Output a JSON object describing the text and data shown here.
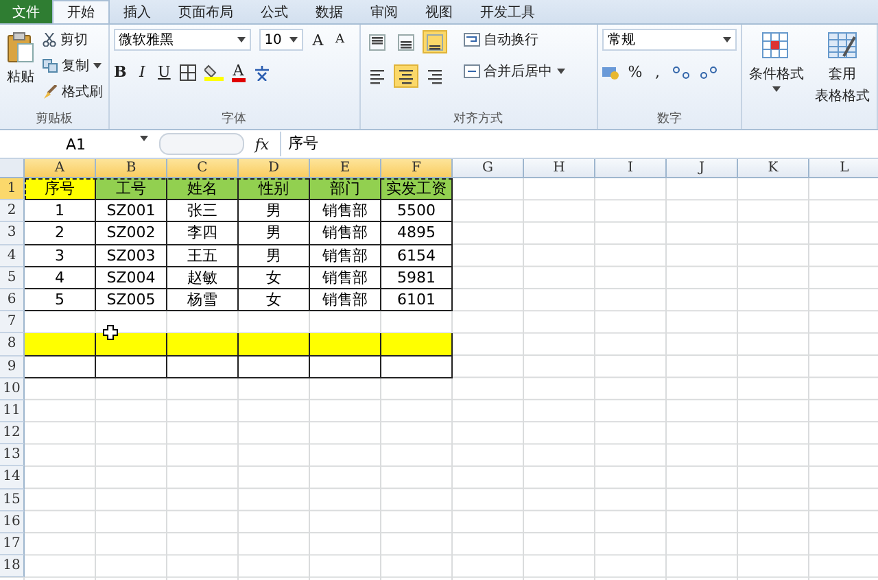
{
  "tabs": [
    {
      "label": "文件",
      "kind": "file",
      "selected": false
    },
    {
      "label": "开始",
      "kind": "tab",
      "selected": true
    },
    {
      "label": "插入",
      "kind": "tab",
      "selected": false
    },
    {
      "label": "页面布局",
      "kind": "tab",
      "selected": false
    },
    {
      "label": "公式",
      "kind": "tab",
      "selected": false
    },
    {
      "label": "数据",
      "kind": "tab",
      "selected": false
    },
    {
      "label": "审阅",
      "kind": "tab",
      "selected": false
    },
    {
      "label": "视图",
      "kind": "tab",
      "selected": false
    },
    {
      "label": "开发工具",
      "kind": "tab",
      "selected": false
    }
  ],
  "clipboard": {
    "paste": "粘贴",
    "cut": "剪切",
    "copy": "复制",
    "format_painter": "格式刷",
    "label": "剪贴板"
  },
  "font": {
    "family": "微软雅黑",
    "size": "10",
    "bold": "B",
    "italic": "I",
    "underline": "U",
    "grow": "A",
    "shrink": "A",
    "font_color": "A",
    "label": "字体"
  },
  "alignment": {
    "wrap": "自动换行",
    "merge": "合并后居中",
    "label": "对齐方式",
    "buttons": [
      {
        "kind": "top",
        "selected": false
      },
      {
        "kind": "middle",
        "selected": false
      },
      {
        "kind": "bottom",
        "selected": true
      },
      {
        "kind": "left",
        "selected": false
      },
      {
        "kind": "center",
        "selected": true
      },
      {
        "kind": "right",
        "selected": false
      }
    ]
  },
  "number": {
    "format": "常规",
    "percent": "%",
    "comma": ",",
    "label": "数字"
  },
  "styles": {
    "conditional": "条件格式",
    "table_line_1": "套用",
    "table_line_2": "表格格式"
  },
  "formula_bar": {
    "name_box": "A1",
    "fx": "fx",
    "formula": "序号"
  },
  "columns": [
    {
      "label": "A",
      "selected": true
    },
    {
      "label": "B",
      "selected": true
    },
    {
      "label": "C",
      "selected": true
    },
    {
      "label": "D",
      "selected": true
    },
    {
      "label": "E",
      "selected": true
    },
    {
      "label": "F",
      "selected": true
    },
    {
      "label": "G",
      "selected": false
    },
    {
      "label": "H",
      "selected": false
    },
    {
      "label": "I",
      "selected": false
    },
    {
      "label": "J",
      "selected": false
    },
    {
      "label": "K",
      "selected": false
    },
    {
      "label": "L",
      "selected": false
    }
  ],
  "rows": [
    {
      "number": "1",
      "selected": true,
      "copied": true,
      "cells": [
        {
          "text": "序号",
          "color": "#ffff00"
        },
        {
          "text": "工号",
          "color": "#92d050"
        },
        {
          "text": "姓名",
          "color": "#92d050"
        },
        {
          "text": "性别",
          "color": "#92d050"
        },
        {
          "text": "部门",
          "color": "#92d050"
        },
        {
          "text": "实发工资",
          "color": "#92d050"
        }
      ]
    },
    {
      "number": "2",
      "selected": false,
      "copied": false,
      "cells": [
        {
          "text": "1"
        },
        {
          "text": "SZ001"
        },
        {
          "text": "张三"
        },
        {
          "text": "男"
        },
        {
          "text": "销售部"
        },
        {
          "text": "5500"
        }
      ]
    },
    {
      "number": "3",
      "selected": false,
      "copied": false,
      "cells": [
        {
          "text": "2"
        },
        {
          "text": "SZ002"
        },
        {
          "text": "李四"
        },
        {
          "text": "男"
        },
        {
          "text": "销售部"
        },
        {
          "text": "4895"
        }
      ]
    },
    {
      "number": "4",
      "selected": false,
      "copied": false,
      "cells": [
        {
          "text": "3"
        },
        {
          "text": "SZ003"
        },
        {
          "text": "王五"
        },
        {
          "text": "男"
        },
        {
          "text": "销售部"
        },
        {
          "text": "6154"
        }
      ]
    },
    {
      "number": "5",
      "selected": false,
      "copied": false,
      "cells": [
        {
          "text": "4"
        },
        {
          "text": "SZ004"
        },
        {
          "text": "赵敏"
        },
        {
          "text": "女"
        },
        {
          "text": "销售部"
        },
        {
          "text": "5981"
        }
      ]
    },
    {
      "number": "6",
      "selected": false,
      "copied": false,
      "cells": [
        {
          "text": "5"
        },
        {
          "text": "SZ005"
        },
        {
          "text": "杨雪"
        },
        {
          "text": "女"
        },
        {
          "text": "销售部"
        },
        {
          "text": "6101"
        }
      ]
    },
    {
      "number": "7",
      "selected": false,
      "copied": false
    },
    {
      "number": "8",
      "selected": false,
      "copied": false,
      "cells": [
        {
          "color": "#ffff00"
        },
        {
          "color": "#ffff00"
        },
        {
          "color": "#ffff00"
        },
        {
          "color": "#ffff00"
        },
        {
          "color": "#ffff00"
        },
        {
          "color": "#ffff00"
        }
      ]
    },
    {
      "number": "9",
      "selected": false,
      "copied": false,
      "cells": [
        {
          "color": "#ffffff"
        },
        {
          "color": "#ffffff"
        },
        {
          "color": "#ffffff"
        },
        {
          "color": "#ffffff"
        },
        {
          "color": "#ffffff"
        },
        {
          "color": "#ffffff"
        }
      ]
    },
    {
      "number": "10",
      "selected": false,
      "copied": false
    },
    {
      "number": "11",
      "selected": false,
      "copied": false
    },
    {
      "number": "12",
      "selected": false,
      "copied": false
    },
    {
      "number": "13",
      "selected": false,
      "copied": false
    },
    {
      "number": "14",
      "selected": false,
      "copied": false
    },
    {
      "number": "15",
      "selected": false,
      "copied": false
    },
    {
      "number": "16",
      "selected": false,
      "copied": false
    },
    {
      "number": "17",
      "selected": false,
      "copied": false
    },
    {
      "number": "18",
      "selected": false,
      "copied": false
    }
  ]
}
